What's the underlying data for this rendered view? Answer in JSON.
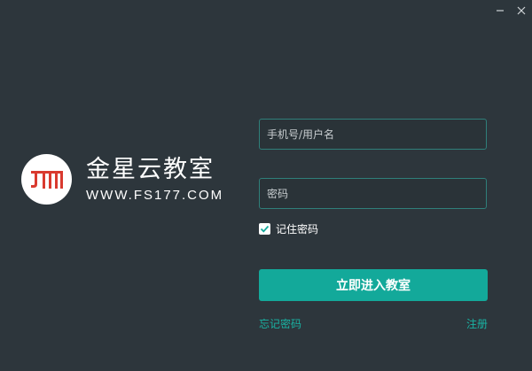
{
  "window": {
    "minimize_icon": "minimize-icon",
    "close_icon": "close-icon"
  },
  "brand": {
    "logo_icon": "jm-logo-icon",
    "logo_color": "#d93a2f",
    "title": "金星云教室",
    "url": "WWW.FS177.COM"
  },
  "form": {
    "username_placeholder": "手机号/用户名",
    "username_value": "",
    "password_placeholder": "密码",
    "password_value": "",
    "remember_label": "记住密码",
    "remember_checked": true,
    "login_label": "立即进入教室",
    "forgot_label": "忘记密码",
    "register_label": "注册"
  },
  "colors": {
    "background": "#2d363c",
    "accent": "#13a99a",
    "link": "#19b3a3",
    "field_border": "#2f7f7a"
  }
}
